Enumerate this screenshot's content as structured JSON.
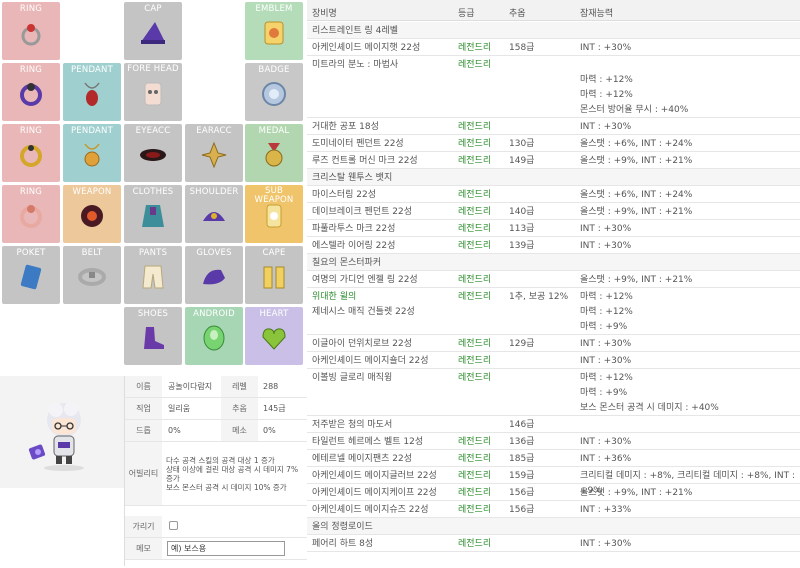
{
  "slots": [
    {
      "label": "RING",
      "icon": "ring-icon",
      "color": "#e9b7b7"
    },
    {
      "label": "CAP",
      "icon": "witch-hat-icon",
      "color": "#c4c4c4"
    },
    {
      "label": "EMBLEM",
      "icon": "emblem-icon",
      "color": "#b4dcb9"
    },
    {
      "label": "RING",
      "icon": "ring-purple-icon",
      "color": "#e9b7b7"
    },
    {
      "label": "PENDANT",
      "icon": "pendant-icon",
      "color": "#9fd0cf"
    },
    {
      "label": "FORE HEAD",
      "icon": "face-accessory-icon",
      "color": "#c4c4c4"
    },
    {
      "label": "BADGE",
      "icon": "badge-icon",
      "color": "#c8c8c8"
    },
    {
      "label": "RING",
      "icon": "ring-gold-icon",
      "color": "#e9b7b7"
    },
    {
      "label": "PENDANT",
      "icon": "pendant-gold-icon",
      "color": "#9fd0cf"
    },
    {
      "label": "EYEACC",
      "icon": "eye-accessory-icon",
      "color": "#c4c4c4"
    },
    {
      "label": "EARACC",
      "icon": "earring-icon",
      "color": "#c4c4c4"
    },
    {
      "label": "MEDAL",
      "icon": "medal-icon",
      "color": "#b2d7b0"
    },
    {
      "label": "RING",
      "icon": "ring-pink-icon",
      "color": "#e9b7b7"
    },
    {
      "label": "WEAPON",
      "icon": "weapon-icon",
      "color": "#ecc89a"
    },
    {
      "label": "CLOTHES",
      "icon": "clothes-icon",
      "color": "#c4c4c4"
    },
    {
      "label": "SHOULDER",
      "icon": "shoulder-icon",
      "color": "#c4c4c4"
    },
    {
      "label": "SUB WEAPON",
      "icon": "sub-weapon-icon",
      "color": "#f0c46a"
    },
    {
      "label": "POKET",
      "icon": "pocket-book-icon",
      "color": "#c4c4c4"
    },
    {
      "label": "BELT",
      "icon": "belt-icon",
      "color": "#c4c4c4"
    },
    {
      "label": "PANTS",
      "icon": "pants-icon",
      "color": "#c4c4c4"
    },
    {
      "label": "GLOVES",
      "icon": "gloves-icon",
      "color": "#c4c4c4"
    },
    {
      "label": "CAPE",
      "icon": "cape-icon",
      "color": "#c4c4c4"
    },
    {
      "label": "SHOES",
      "icon": "shoes-icon",
      "color": "#c4c4c4"
    },
    {
      "label": "ANDROID",
      "icon": "android-heart-egg-icon",
      "color": "#a6d6b4"
    },
    {
      "label": "HEART",
      "icon": "mechanical-heart-icon",
      "color": "#c9bfe7"
    }
  ],
  "info": {
    "name_label": "이름",
    "name": "공놀이다람지",
    "level_label": "레벨",
    "level": "288",
    "job_label": "직업",
    "job": "일리움",
    "star_label": "추옵",
    "star": "145급",
    "drop_label": "드롭",
    "drop": "0%",
    "meso_label": "메소",
    "meso": "0%",
    "ability_label": "어빌리티",
    "ability": [
      "다수 공격 스킬의 공격 대상 1 증가",
      "상태 이상에 걸린 대상 공격 시 데미지 7% 증가",
      "보스 몬스터 공격 시 데미지 10% 증가"
    ],
    "hide_label": "가리기",
    "memo_label": "메모",
    "memo": "예) 보스용"
  },
  "table": {
    "headers": {
      "name": "장비명",
      "grade": "등급",
      "star": "추옵",
      "pot": "잠재능력"
    },
    "rows": [
      {
        "type": "set",
        "name": "리스트레인트 링 4레벨"
      },
      {
        "name": "아케인셰이드 메이지햇 22성",
        "grade": "레전드리",
        "star": "158급",
        "pot": [
          "INT : +30%"
        ]
      },
      {
        "name": "미트라의 분노 : 마법사",
        "grade": "레전드리",
        "star": "",
        "pot": [
          "",
          "마력 : +12%",
          "마력 : +12%",
          "몬스터 방어율 무시 : +40%"
        ]
      },
      {
        "name": "거대한 공포 18성",
        "grade": "레전드리",
        "star": "",
        "pot": [
          "INT : +30%"
        ]
      },
      {
        "name": "도미네이터 펜던트 22성",
        "grade": "레전드리",
        "star": "130급",
        "pot": [
          "올스탯 : +6%, INT : +24%"
        ]
      },
      {
        "name": "루즈 컨트롤 머신 마크 22성",
        "grade": "레전드리",
        "star": "149급",
        "pot": [
          "올스탯 : +9%, INT : +21%"
        ]
      },
      {
        "type": "set",
        "name": "크리스탈 웬투스 뱃지"
      },
      {
        "name": "마이스터링 22성",
        "grade": "레전드리",
        "star": "",
        "pot": [
          "올스탯 : +6%, INT : +24%"
        ]
      },
      {
        "name": "데이브레이크 펜던트 22성",
        "grade": "레전드리",
        "star": "140급",
        "pot": [
          "올스탯 : +9%, INT : +21%"
        ]
      },
      {
        "name": "파풀라투스 마크 22성",
        "grade": "레전드리",
        "star": "113급",
        "pot": [
          "INT : +30%"
        ]
      },
      {
        "name": "에스텔라 이어링 22성",
        "grade": "레전드리",
        "star": "139급",
        "pot": [
          "INT : +30%"
        ]
      },
      {
        "type": "set",
        "name": "칠요의 몬스터파커"
      },
      {
        "name": "여명의 가디언 엔젤 링 22성",
        "grade": "레전드리",
        "star": "",
        "pot": [
          "올스탯 : +9%, INT : +21%"
        ]
      },
      {
        "name": "위대한 윌의",
        "name2": "제네시스 매직 건틀렛 22성",
        "grade": "레전드리",
        "star": "1추, 보공 12%",
        "pot": [
          "마력 : +12%",
          "마력 : +12%",
          "마력 : +9%"
        ]
      },
      {
        "name": "이글아이 던위치로브 22성",
        "grade": "레전드리",
        "star": "129급",
        "pot": [
          "INT : +30%"
        ]
      },
      {
        "name": "아케인셰이드 메이지숄더 22성",
        "grade": "레전드리",
        "star": "",
        "pot": [
          "INT : +30%"
        ]
      },
      {
        "name": "이볼빙 글로리 매직윙",
        "grade": "레전드리",
        "star": "",
        "pot": [
          "마력 : +12%",
          "마력 : +9%",
          "보스 몬스터 공격 시 데미지 : +40%"
        ]
      },
      {
        "name": "저주받은 청의 마도서",
        "grade": "",
        "star": "146급",
        "pot": [
          ""
        ]
      },
      {
        "name": "타일런트 헤르메스 벨트 12성",
        "grade": "레전드리",
        "star": "136급",
        "pot": [
          "INT : +30%"
        ]
      },
      {
        "name": "에테르넬 메이지팬츠 22성",
        "grade": "레전드리",
        "star": "185급",
        "pot": [
          "INT : +36%"
        ]
      },
      {
        "name": "아케인셰이드 메이지글러브 22성",
        "grade": "레전드리",
        "star": "159급",
        "pot": [
          "크리티컬 데미지 : +8%, 크리티컬 데미지 : +8%, INT : +9%"
        ]
      },
      {
        "name": "아케인셰이드 메이지케이프 22성",
        "grade": "레전드리",
        "star": "156급",
        "pot": [
          "올스탯 : +9%, INT : +21%"
        ]
      },
      {
        "name": "아케인셰이드 메이지슈즈 22성",
        "grade": "레전드리",
        "star": "156급",
        "pot": [
          "INT : +33%"
        ]
      },
      {
        "type": "set",
        "name": "올의 정령로이드"
      },
      {
        "name": "페어리 하트 8성",
        "grade": "레전드리",
        "star": "",
        "pot": [
          "INT : +30%"
        ]
      }
    ]
  }
}
